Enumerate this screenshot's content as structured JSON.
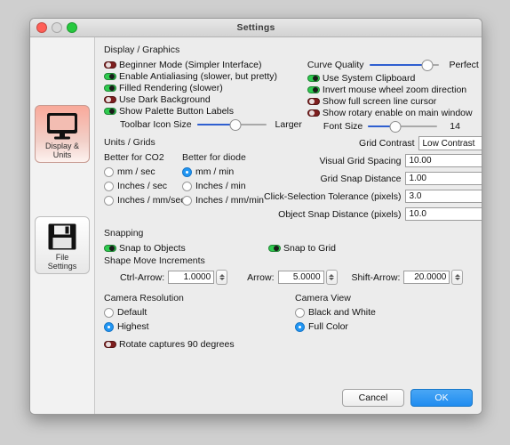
{
  "window": {
    "title": "Settings",
    "traffic_lights": [
      "close",
      "minimize",
      "zoom"
    ]
  },
  "sidebar": {
    "items": [
      {
        "label_line1": "Display &",
        "label_line2": "Units",
        "icon": "monitor-icon",
        "selected": true
      },
      {
        "label_line1": "File",
        "label_line2": "Settings",
        "icon": "floppy-disk-icon",
        "selected": false
      }
    ]
  },
  "display_graphics": {
    "title": "Display / Graphics",
    "left_toggles": [
      {
        "label": "Beginner Mode (Simpler Interface)",
        "on": false
      },
      {
        "label": "Enable Antialiasing (slower, but pretty)",
        "on": true
      },
      {
        "label": "Filled Rendering (slower)",
        "on": true
      },
      {
        "label": "Use Dark Background",
        "on": false
      },
      {
        "label": "Show Palette Button Labels",
        "on": true
      }
    ],
    "right_toggles": [
      {
        "label": "Use System Clipboard",
        "on": true
      },
      {
        "label": "Invert mouse wheel zoom direction",
        "on": true
      },
      {
        "label": "Show full screen line cursor",
        "on": false
      },
      {
        "label": "Show rotary enable on main window",
        "on": false
      }
    ],
    "toolbar_icon_size": {
      "label": "Toolbar Icon Size",
      "value_label": "Larger",
      "percent": 56
    },
    "curve_quality": {
      "label": "Curve Quality",
      "value_label": "Perfect",
      "percent": 84
    },
    "font_size": {
      "label": "Font Size",
      "value_label": "14",
      "percent": 40
    }
  },
  "units_grids": {
    "title": "Units / Grids",
    "col1_head": "Better for CO2",
    "col2_head": "Better for diode",
    "col1_options": [
      {
        "label": "mm / sec",
        "selected": false
      },
      {
        "label": "Inches / sec",
        "selected": false
      },
      {
        "label": "Inches / mm/sec",
        "selected": false
      }
    ],
    "col2_options": [
      {
        "label": "mm / min",
        "selected": true
      },
      {
        "label": "Inches / min",
        "selected": false
      },
      {
        "label": "Inches / mm/min",
        "selected": false
      }
    ],
    "grid_contrast": {
      "label": "Grid Contrast",
      "value": "Low Contrast"
    },
    "fields": [
      {
        "label": "Visual Grid Spacing",
        "value": "10.00"
      },
      {
        "label": "Grid Snap Distance",
        "value": "1.00"
      },
      {
        "label": "Click-Selection Tolerance (pixels)",
        "value": "3.0"
      },
      {
        "label": "Object Snap Distance (pixels)",
        "value": "10.0"
      }
    ]
  },
  "snapping": {
    "title": "Snapping",
    "snap_to_objects": {
      "label": "Snap to Objects",
      "on": true
    },
    "snap_to_grid": {
      "label": "Snap to Grid",
      "on": true
    },
    "shape_move_title": "Shape Move Increments",
    "increments": [
      {
        "label": "Ctrl-Arrow:",
        "value": "1.0000"
      },
      {
        "label": "Arrow:",
        "value": "5.0000"
      },
      {
        "label": "Shift-Arrow:",
        "value": "20.0000"
      }
    ]
  },
  "camera": {
    "resolution_title": "Camera Resolution",
    "resolution_options": [
      {
        "label": "Default",
        "selected": false
      },
      {
        "label": "Highest",
        "selected": true
      }
    ],
    "view_title": "Camera View",
    "view_options": [
      {
        "label": "Black and White",
        "selected": false
      },
      {
        "label": "Full Color",
        "selected": true
      }
    ],
    "rotate_toggle": {
      "label": "Rotate captures 90 degrees",
      "on": false
    }
  },
  "footer": {
    "cancel_label": "Cancel",
    "ok_label": "OK"
  },
  "colors": {
    "accent_blue": "#2196f3",
    "toggle_on": "#2fcb4f",
    "toggle_off": "#7e1e1e",
    "slider_fill": "#2f5fd0"
  }
}
